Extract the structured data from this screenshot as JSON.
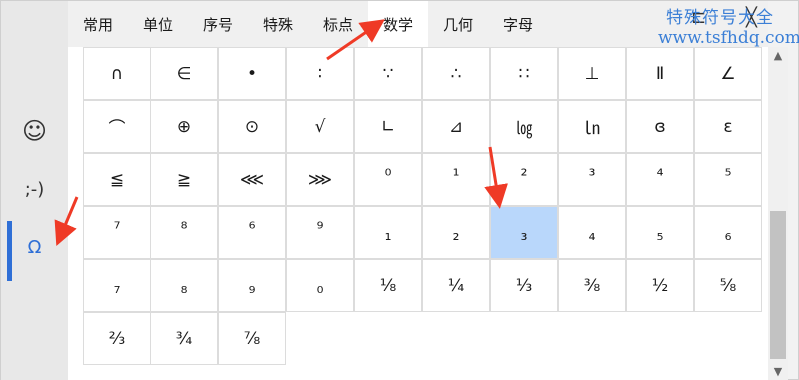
{
  "watermark": {
    "line1": "特殊符号大全",
    "line2": "www.tsfhdq.com"
  },
  "window_controls": {
    "pin": "⊏",
    "close": "╳"
  },
  "rail": [
    {
      "glyph": "☺",
      "icon": "emoji-icon"
    },
    {
      "glyph": ";-)",
      "icon": "emoticon-icon"
    },
    {
      "glyph": "Ω",
      "icon": "symbol-omega-icon",
      "active": true
    }
  ],
  "tabs": [
    "常用",
    "单位",
    "序号",
    "特殊",
    "标点",
    "数学",
    "几何",
    "字母"
  ],
  "selected_tab": "数学",
  "grid": {
    "rows": [
      [
        "∩",
        "∈",
        "•",
        "∶",
        "∵",
        "∴",
        "∷",
        "⊥",
        "Ⅱ",
        "∠"
      ],
      [
        "⌒",
        "⊕",
        "⊙",
        "√",
        "∟",
        "⊿",
        "㏒",
        "㏑",
        "ɞ",
        "ɛ"
      ],
      [
        "≦",
        "≧",
        "⋘",
        "⋙",
        "⁰",
        "¹",
        "²",
        "³",
        "⁴",
        "⁵"
      ],
      [
        "⁷",
        "⁸",
        "⁶",
        "⁹",
        "₁",
        "₂",
        "₃",
        "₄",
        "₅",
        "₆"
      ],
      [
        "₇",
        "₈",
        "₉",
        "₀",
        "⅛",
        "¼",
        "⅓",
        "⅜",
        "½",
        "⅝"
      ],
      [
        "⅔",
        "¾",
        "⅞"
      ]
    ],
    "selected_symbol": "₃"
  },
  "scrollbar": {
    "up": "▲",
    "down": "▼"
  },
  "colors": {
    "accent": "#2f6fd6",
    "selection": "#b9d7fb",
    "arrow": "#ef3a26",
    "watermark": "#3b7fd6"
  }
}
